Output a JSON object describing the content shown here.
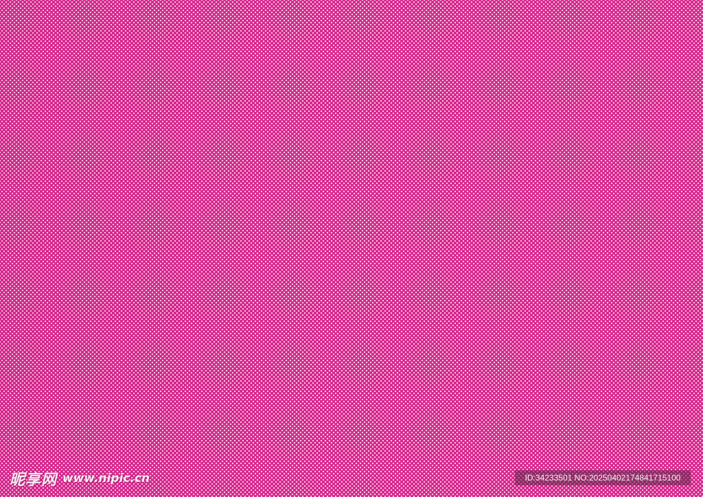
{
  "background": {
    "pattern": "white polka-dot halftone",
    "base_color": "#d8288e",
    "dot_color": "#ffffff"
  },
  "watermark": {
    "logo_text": "昵享网",
    "url_text": "www.nipic.cn",
    "id_text": "ID:34233501 NO:20250402174841715100"
  }
}
